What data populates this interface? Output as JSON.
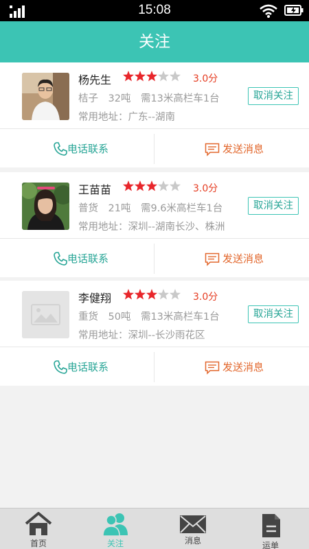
{
  "status": {
    "time": "15:08"
  },
  "header": {
    "title": "关注"
  },
  "actions": {
    "call_label": "电话联系",
    "message_label": "发送消息",
    "unfollow_label": "取消关注"
  },
  "colors": {
    "accent": "#3cc4b4",
    "star_on": "#e8262b",
    "star_off": "#c9c9c9",
    "score": "#e53a1f",
    "message": "#e2662b"
  },
  "contacts": [
    {
      "name": "杨先生",
      "rating": 3,
      "max_rating": 5,
      "score": "3.0分",
      "info": "桔子　32吨　需13米高栏车1台",
      "address": "常用地址：广东--湖南",
      "avatar": "man-photo"
    },
    {
      "name": "王苗苗",
      "rating": 3,
      "max_rating": 5,
      "score": "3.0分",
      "info": "普货　21吨　需9.6米高栏车1台",
      "address": "常用地址：深圳--湖南长沙、株洲",
      "avatar": "woman-photo"
    },
    {
      "name": "李健翔",
      "rating": 3,
      "max_rating": 5,
      "score": "3.0分",
      "info": "重货　50吨　需13米高栏车1台",
      "address": "常用地址：深圳--长沙雨花区",
      "avatar": "placeholder-image-icon"
    }
  ],
  "tabs": [
    {
      "label": "首页",
      "icon": "home-icon",
      "active": false
    },
    {
      "label": "关注",
      "icon": "people-icon",
      "active": true
    },
    {
      "label": "消息",
      "icon": "envelope-icon",
      "active": false
    },
    {
      "label": "运单",
      "icon": "document-icon",
      "active": false
    }
  ]
}
